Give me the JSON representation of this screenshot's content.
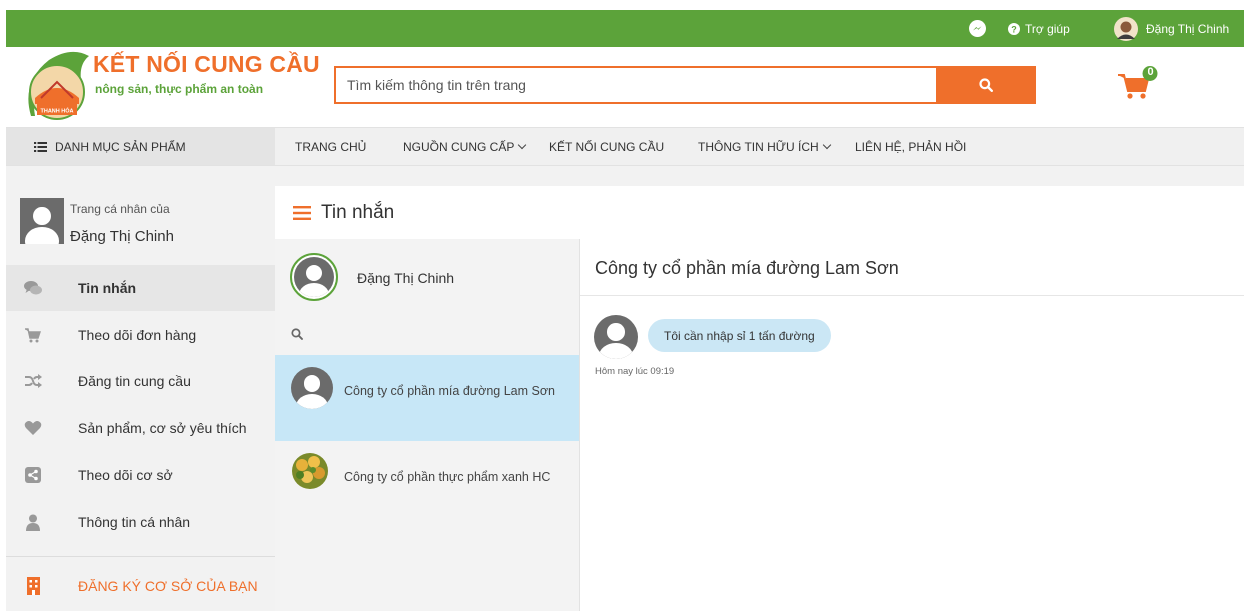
{
  "topbar": {
    "help_label": "Trợ giúp",
    "user_name": "Đặng Thị Chinh"
  },
  "brand": {
    "badge_text": "THANH HÓA",
    "title": "KẾT NỐI CUNG CẦU",
    "tagline": "nông sản, thực phẩm an toàn"
  },
  "search": {
    "placeholder": "Tìm kiếm thông tin trên trang"
  },
  "cart": {
    "count": "0"
  },
  "nav": {
    "category_label": "DANH MỤC SẢN PHẨM",
    "items": [
      {
        "label": "TRANG CHỦ"
      },
      {
        "label": "NGUỒN CUNG CẤP"
      },
      {
        "label": "KẾT NỐI CUNG CẦU"
      },
      {
        "label": "THÔNG TIN HỮU ÍCH"
      },
      {
        "label": "LIÊN HỆ, PHẢN HỒI"
      }
    ]
  },
  "sidebar": {
    "profile_caption": "Trang cá nhân của",
    "profile_name": "Đặng Thị Chinh",
    "items": [
      {
        "label": "Tin nhắn",
        "icon": "chat-icon"
      },
      {
        "label": "Theo dõi đơn hàng",
        "icon": "cart-icon"
      },
      {
        "label": "Đăng tin cung cầu",
        "icon": "shuffle-icon"
      },
      {
        "label": "Sản phẩm, cơ sở yêu thích",
        "icon": "heart-icon"
      },
      {
        "label": "Theo dõi cơ sở",
        "icon": "share-icon"
      },
      {
        "label": "Thông tin cá nhân",
        "icon": "user-icon"
      }
    ],
    "register_label": "ĐĂNG KÝ CƠ SỞ CỦA BẠN"
  },
  "messages": {
    "title": "Tin nhắn",
    "me_name": "Đặng Thị Chinh",
    "conversations": [
      {
        "name": "Công ty cổ phần mía đường Lam Sơn"
      },
      {
        "name": "Công ty cổ phần thực phẩm xanh HC"
      }
    ],
    "chat_title": "Công ty cổ phần mía đường Lam Sơn",
    "message_text": "Tôi cần nhập sỉ 1 tấn đường",
    "message_time": "Hôm nay lúc 09:19"
  },
  "colors": {
    "brand_green": "#5ca33a",
    "brand_orange": "#ef6f2b",
    "active_conversation": "#c7e7f7",
    "message_bubble": "#cbe7f5"
  }
}
